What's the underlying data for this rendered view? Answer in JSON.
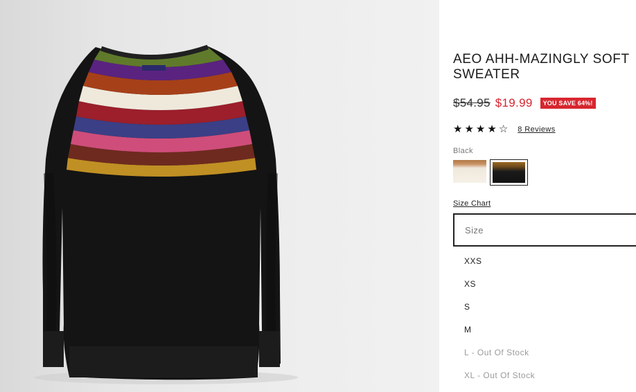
{
  "product": {
    "title": "AEO AHH-MAZINGLY SOFT SWEATER",
    "old_price": "$54.95",
    "sale_price": "$19.99",
    "save_badge": "YOU SAVE 64%!",
    "rating": 4,
    "rating_max": 5,
    "reviews_label": "8 Reviews",
    "image_icon": "product-photo"
  },
  "color": {
    "selected_label": "Black",
    "swatches": [
      {
        "name": "cream-swatch",
        "selected": false,
        "color": "#f3ede3"
      },
      {
        "name": "black-swatch",
        "selected": true,
        "color": "#151515"
      }
    ]
  },
  "size": {
    "chart_link": "Size Chart",
    "placeholder": "Size",
    "options": [
      {
        "label": "XXS",
        "in_stock": true
      },
      {
        "label": "XS",
        "in_stock": true
      },
      {
        "label": "S",
        "in_stock": true
      },
      {
        "label": "M",
        "in_stock": true
      },
      {
        "label": "L - Out Of Stock",
        "in_stock": false
      },
      {
        "label": "XL - Out Of Stock",
        "in_stock": false
      }
    ]
  },
  "colors": {
    "accent_red": "#d7262f",
    "text_dark": "#222222",
    "muted": "#9a9a9a"
  }
}
